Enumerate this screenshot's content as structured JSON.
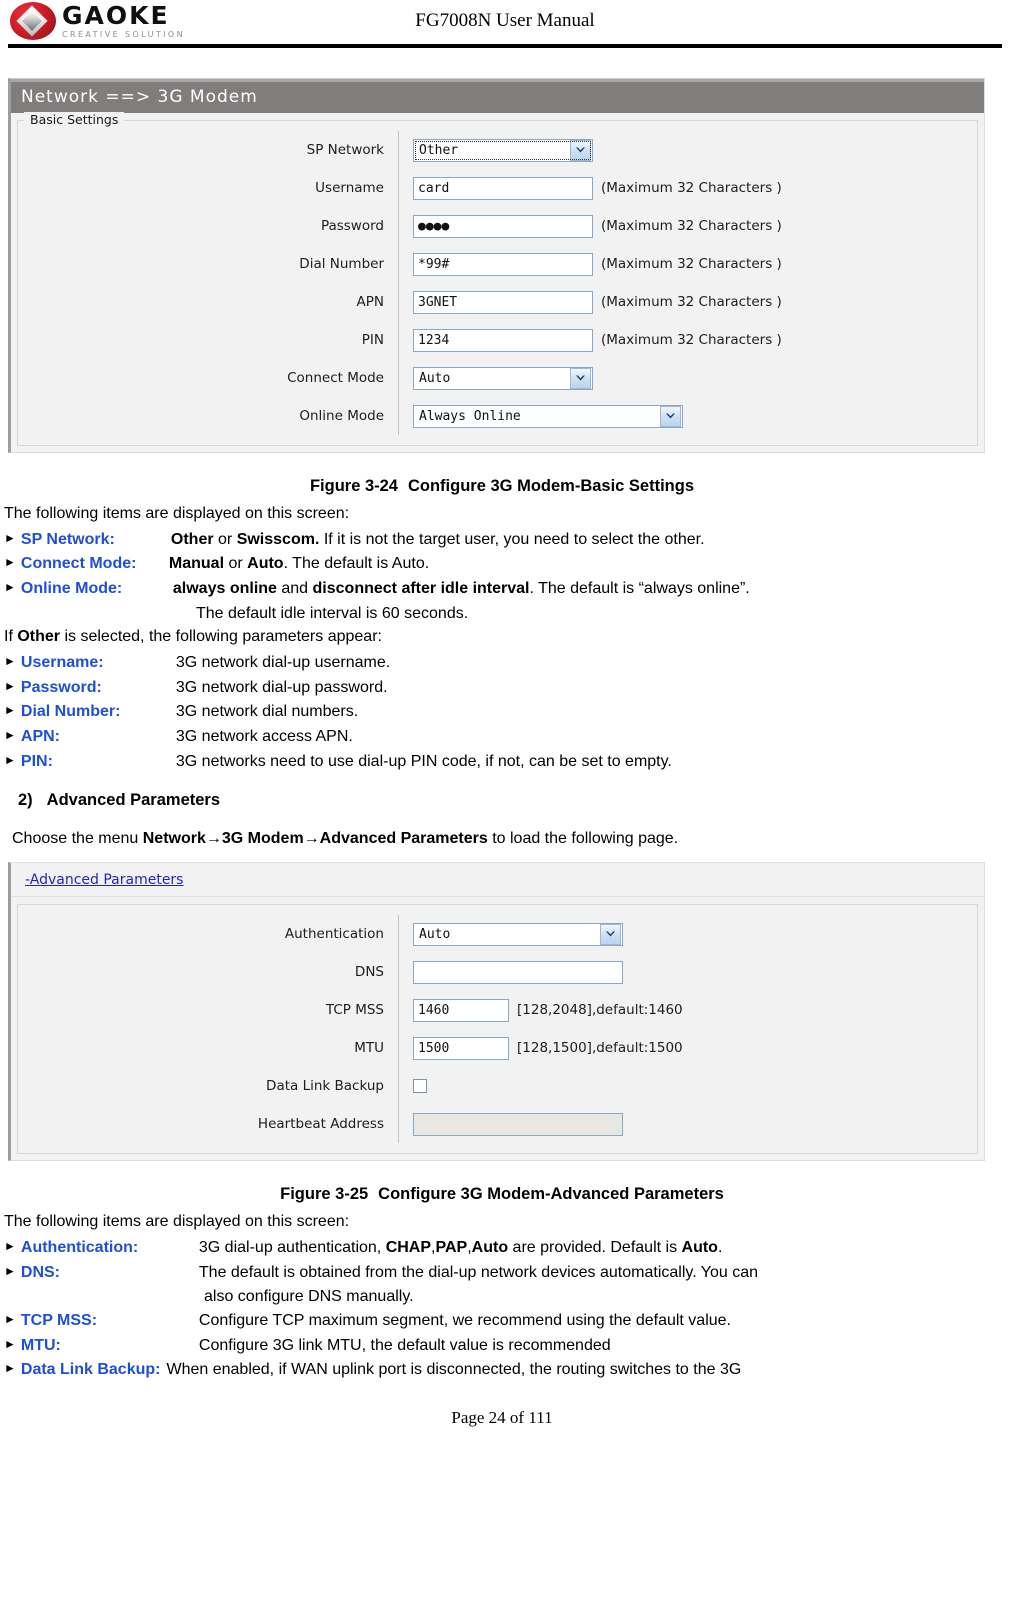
{
  "header": {
    "logo_name": "GAOKE",
    "logo_tagline": "CREATIVE SOLUTION",
    "title": "FG7008N User Manual"
  },
  "basic_panel": {
    "titlebar": "Network ==> 3G Modem",
    "legend": "Basic Settings",
    "max_chars_hint": "(Maximum 32 Characters )",
    "rows": [
      {
        "label": "SP Network",
        "type": "select",
        "value": "Other"
      },
      {
        "label": "Username",
        "type": "text",
        "value": "card"
      },
      {
        "label": "Password",
        "type": "text",
        "value": "●●●●"
      },
      {
        "label": "Dial Number",
        "type": "text",
        "value": "*99#"
      },
      {
        "label": "APN",
        "type": "text",
        "value": "3GNET"
      },
      {
        "label": "PIN",
        "type": "text",
        "value": "1234"
      },
      {
        "label": "Connect Mode",
        "type": "select",
        "value": "Auto"
      },
      {
        "label": "Online Mode",
        "type": "select",
        "value": "Always Online"
      }
    ]
  },
  "advanced_panel": {
    "link_label": "-Advanced Parameters",
    "rows": [
      {
        "label": "Authentication",
        "type": "select",
        "value": "Auto",
        "hint": ""
      },
      {
        "label": "DNS",
        "type": "text",
        "value": "",
        "hint": ""
      },
      {
        "label": "TCP MSS",
        "type": "text",
        "value": "1460",
        "hint": "[128,2048],default:1460"
      },
      {
        "label": "MTU",
        "type": "text",
        "value": "1500",
        "hint": "[128,1500],default:1500"
      },
      {
        "label": "Data Link Backup",
        "type": "checkbox",
        "value": "",
        "hint": ""
      },
      {
        "label": "Heartbeat Address",
        "type": "disabled",
        "value": "",
        "hint": ""
      }
    ]
  },
  "doc": {
    "fig324_num": "Figure 3-24",
    "fig324_title": "Configure 3G Modem-Basic Settings",
    "intro1": "The following items are displayed on this screen:",
    "sp_network_term": "SP Network:",
    "sp_network_b1": "Other",
    "sp_network_mid": " or ",
    "sp_network_b2": "Swisscom.",
    "sp_network_rest": " If it is not the target user, you need to select the other.",
    "connect_mode_term": "Connect Mode:",
    "connect_mode_b1": "Manual",
    "connect_mode_mid": " or ",
    "connect_mode_b2": "Auto",
    "connect_mode_rest": ". The default is Auto.",
    "online_mode_term": "Online Mode:",
    "online_mode_b1": "always online",
    "online_mode_mid": " and ",
    "online_mode_b2": "disconnect after idle interval",
    "online_mode_rest": ". The default is “always online”.",
    "online_mode_line2": "The default idle interval is 60 seconds.",
    "if_other_pre": "If ",
    "if_other_b": "Other",
    "if_other_post": " is selected, the following parameters appear:",
    "username_term": "Username:",
    "username_desc": "3G network dial-up username.",
    "password_term": "Password:",
    "password_desc": "3G network dial-up password.",
    "dialnum_term": "Dial Number:",
    "dialnum_desc": "3G network dial numbers.",
    "apn_term": "APN:",
    "apn_desc": "3G network access APN.",
    "pin_term": "PIN:",
    "pin_desc": "3G networks need to use dial-up PIN code, if not, can be set to empty.",
    "section2_num": "2)",
    "section2_title": "Advanced Parameters",
    "choose_pre": "Choose the menu ",
    "choose_b": "Network→3G Modem→Advanced Parameters",
    "choose_post": " to load the following page.",
    "fig325_num": "Figure 3-25",
    "fig325_title": "Configure 3G Modem-Advanced Parameters",
    "intro2": "The following items are displayed on this screen:",
    "auth_term": "Authentication:",
    "auth_pre": "3G dial-up authentication, ",
    "auth_b1": "CHAP",
    "auth_sep1": ",",
    "auth_b2": "PAP",
    "auth_sep2": ",",
    "auth_b3": "Auto",
    "auth_mid": " are provided. Default is ",
    "auth_b4": "Auto",
    "auth_post": ".",
    "dns_term": "DNS:",
    "dns_desc": "The default is obtained from the dial-up network devices automatically. You can",
    "dns_desc_line2": "also configure DNS manually.",
    "tcpmss_term": "TCP MSS:",
    "tcpmss_desc": "Configure TCP maximum segment, we recommend using the default value.",
    "mtu_term": "MTU:",
    "mtu_desc": "Configure 3G link MTU, the default value is recommended",
    "dlb_term": "Data Link Backup:",
    "dlb_desc": "When enabled, if WAN uplink port is disconnected, the routing switches to the 3G",
    "page_footer": "Page 24 of 111"
  },
  "colors": {
    "term_blue": "#1f4ed8",
    "titlebar_gray": "#807d7d",
    "link_blue": "#2222cc"
  }
}
